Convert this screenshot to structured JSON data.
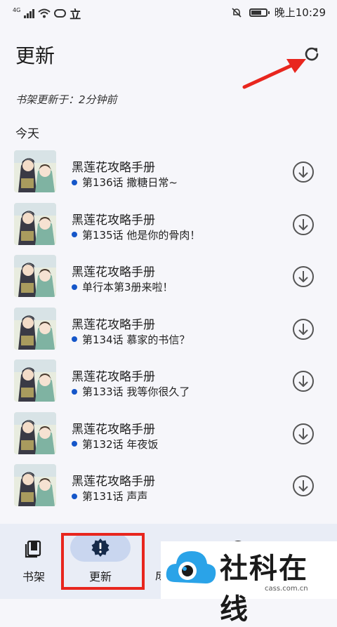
{
  "status_bar": {
    "network": "4G",
    "carrier_mark": "立",
    "time": "晚上10:29",
    "battery_level": 0.7,
    "icons": [
      "signal-icon",
      "wifi-icon",
      "wechat-icon",
      "mute-bell-icon",
      "battery-icon"
    ]
  },
  "header": {
    "title": "更新",
    "refresh_icon": "refresh-icon",
    "shelf_updated": "书架更新于：2分钟前"
  },
  "section": {
    "label": "今天"
  },
  "items": [
    {
      "title": "黑莲花攻略手册",
      "chapter": "第136话 撒糖日常~"
    },
    {
      "title": "黑莲花攻略手册",
      "chapter": "第135话 他是你的骨肉！"
    },
    {
      "title": "黑莲花攻略手册",
      "chapter": "单行本第3册来啦！"
    },
    {
      "title": "黑莲花攻略手册",
      "chapter": "第134话 慕家的书信？"
    },
    {
      "title": "黑莲花攻略手册",
      "chapter": "第133话 我等你很久了"
    },
    {
      "title": "黑莲花攻略手册",
      "chapter": "第132话 年夜饭"
    },
    {
      "title": "黑莲花攻略手册",
      "chapter": "第131话 声声"
    }
  ],
  "tabs": {
    "shelf": "书架",
    "update": "更新",
    "partial": "成"
  },
  "colors": {
    "accent_dot": "#1556c9",
    "annotation_red": "#e8261e",
    "tab_pill": "#c9d6ef",
    "tabbar_bg": "#e9edf6"
  },
  "watermark": {
    "text": "社科在线",
    "url": "cass.com.cn"
  }
}
